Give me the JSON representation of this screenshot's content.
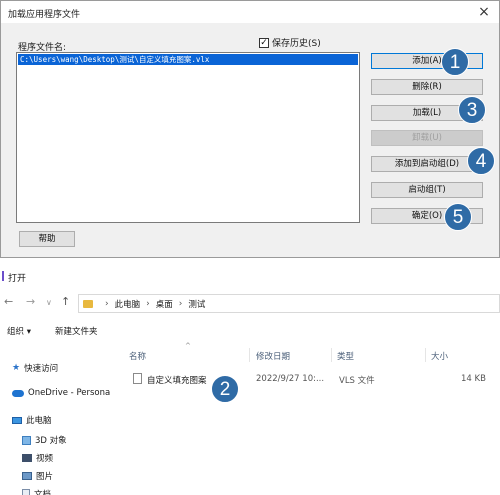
{
  "load_dialog": {
    "title": "加载应用程序文件",
    "close_glyph": "×",
    "file_label": "程序文件名:",
    "save_history": {
      "label": "保存历史(S)",
      "checked_glyph": "✓"
    },
    "files": [
      "C:\\Users\\wang\\Desktop\\测试\\自定义填充图案.vlx"
    ],
    "buttons": {
      "add": "添加(A)",
      "delete": "删除(R)",
      "load": "加载(L)",
      "unload": "卸载(U)",
      "add_startup": "添加到启动组(D)",
      "startup_group": "启动组(T)",
      "ok": "确定(O)",
      "help": "帮助"
    }
  },
  "steps": [
    "1",
    "2",
    "3",
    "4",
    "5"
  ],
  "open_dialog": {
    "title": "打开",
    "nav": {
      "back": "←",
      "forward": "→",
      "dropdown": "∨",
      "up": "↑"
    },
    "breadcrumb": [
      "此电脑",
      "桌面",
      "测试"
    ],
    "breadcrumb_sep": "›",
    "toolbar": {
      "organize": "组织 ▾",
      "new_folder": "新建文件夹"
    },
    "nav_pane": {
      "quick_access": "快速访问",
      "onedrive": "OneDrive - Persona",
      "this_pc": "此电脑",
      "objects_3d": "3D 对象",
      "videos": "视频",
      "pictures": "图片",
      "documents": "文档"
    },
    "columns": {
      "name": "名称",
      "date": "修改日期",
      "type": "类型",
      "size": "大小",
      "sort": "^"
    },
    "file": {
      "name": "自定义填充图案",
      "date": "2022/9/27 10:...",
      "type": "VLS 文件",
      "size": "14 KB"
    }
  },
  "colors": {
    "badge": "#2f6ba6",
    "selection": "#0a64d6",
    "default_button_border": "#0078d7"
  }
}
